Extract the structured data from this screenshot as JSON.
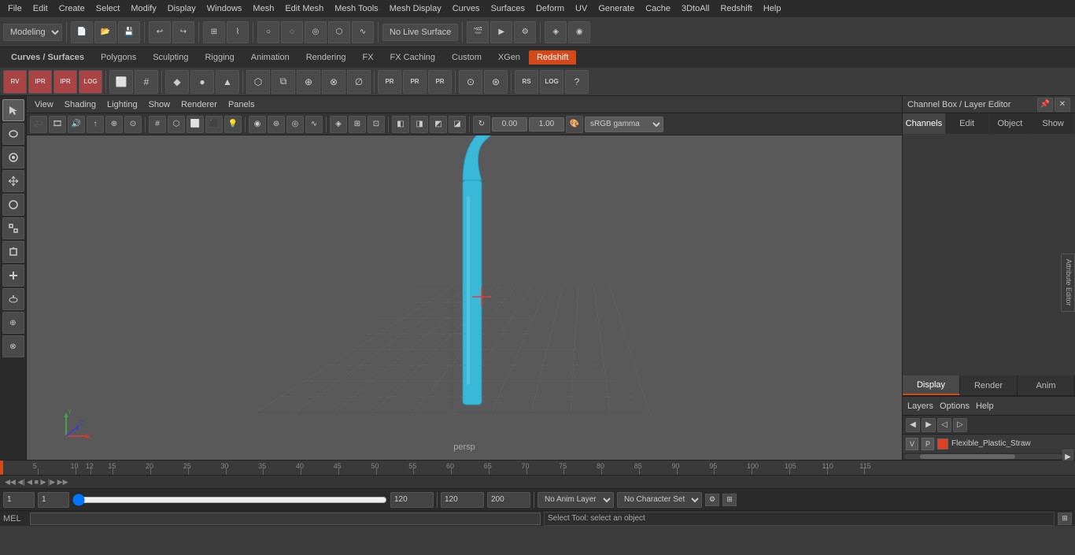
{
  "menubar": {
    "items": [
      "File",
      "Edit",
      "Create",
      "Select",
      "Modify",
      "Display",
      "Windows",
      "Mesh",
      "Edit Mesh",
      "Mesh Tools",
      "Mesh Display",
      "Curves",
      "Surfaces",
      "Deform",
      "UV",
      "Generate",
      "Cache",
      "3DtoAll",
      "Redshift",
      "Help"
    ]
  },
  "top_toolbar": {
    "mode_dropdown": "Modeling",
    "live_surface_btn": "No Live Surface"
  },
  "module_tabs": {
    "items": [
      "Curves / Surfaces",
      "Polygons",
      "Sculpting",
      "Rigging",
      "Animation",
      "Rendering",
      "FX",
      "FX Caching",
      "Custom",
      "XGen",
      "Redshift"
    ],
    "active": "Redshift"
  },
  "viewport": {
    "view_menu": "View",
    "shading_menu": "Shading",
    "lighting_menu": "Lighting",
    "show_menu": "Show",
    "renderer_menu": "Renderer",
    "panels_menu": "Panels",
    "camera_label": "persp",
    "coord_value": "0.00",
    "scale_value": "1.00",
    "color_mode": "sRGB gamma"
  },
  "channel_box": {
    "title": "Channel Box / Layer Editor",
    "tabs": {
      "channels": "Channels",
      "edit": "Edit",
      "object": "Object",
      "show": "Show"
    },
    "display_tabs": {
      "display": "Display",
      "render": "Render",
      "anim": "Anim"
    },
    "layers_label": "Layers",
    "layers_menu": {
      "layers": "Layers",
      "options": "Options",
      "help": "Help"
    },
    "layer_item": {
      "v": "V",
      "p": "P",
      "name": "Flexible_Plastic_Straw"
    }
  },
  "timeline": {
    "current_frame": "1",
    "start_frame": "1",
    "end_frame": "120",
    "range_start": "120",
    "range_end": "200",
    "playback_speed": "No Anim Layer",
    "character_set": "No Character Set",
    "tick_labels": [
      "5",
      "10",
      "15",
      "20",
      "25",
      "30",
      "35",
      "40",
      "45",
      "50",
      "55",
      "60",
      "65",
      "70",
      "75",
      "80",
      "85",
      "90",
      "95",
      "100",
      "105",
      "110",
      "115",
      "12"
    ]
  },
  "command_line": {
    "mode_label": "MEL",
    "status_text": "Select Tool: select an object"
  },
  "status_bar_bottom": {
    "frame_indicator": "1",
    "frame_value": "1",
    "range_indicator": "120"
  }
}
